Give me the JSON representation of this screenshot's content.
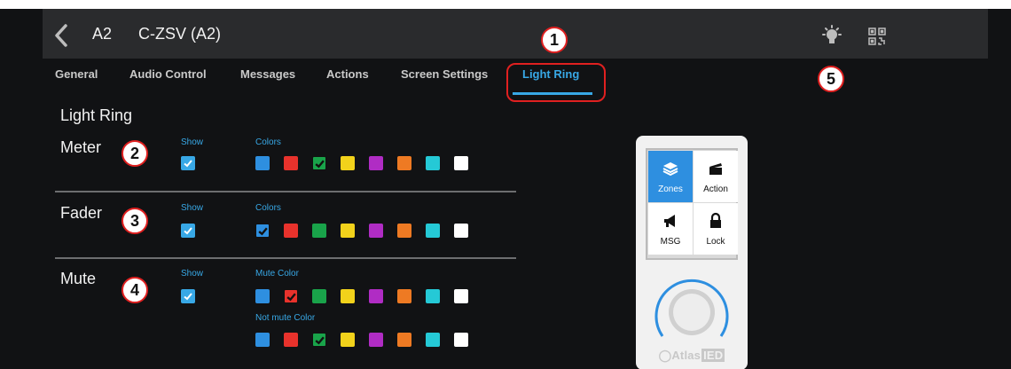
{
  "header": {
    "back_icon": "chevron-left-icon",
    "device_id": "A2",
    "device_title": "C-ZSV (A2)",
    "icons": [
      "light-bulb-icon",
      "qr-code-icon"
    ]
  },
  "tabs": [
    {
      "label": "General",
      "active": false
    },
    {
      "label": "Audio Control",
      "active": false
    },
    {
      "label": "Messages",
      "active": false
    },
    {
      "label": "Actions",
      "active": false
    },
    {
      "label": "Screen Settings",
      "active": false
    },
    {
      "label": "Light Ring",
      "active": true
    }
  ],
  "section_title": "Light Ring",
  "callouts": [
    "1",
    "2",
    "3",
    "4",
    "5"
  ],
  "accent_color": "#38a8e6",
  "palette": [
    "#2e8fe0",
    "#e8322c",
    "#19a34a",
    "#f2d21b",
    "#b02cc4",
    "#ee7a23",
    "#25c9d6",
    "#ffffff"
  ],
  "rows": {
    "meter": {
      "label": "Meter",
      "show_label": "Show",
      "show": true,
      "colors_label": "Colors",
      "selected_index": 2
    },
    "fader": {
      "label": "Fader",
      "show_label": "Show",
      "show": true,
      "colors_label": "Colors",
      "selected_index": 0
    },
    "mute": {
      "label": "Mute",
      "show_label": "Show",
      "show": true,
      "mute_color_label": "Mute Color",
      "mute_selected_index": 1,
      "not_mute_color_label": "Not mute Color",
      "not_mute_selected_index": 2
    }
  },
  "device_preview": {
    "cells": [
      {
        "label": "Zones",
        "icon": "layers-icon",
        "selected": true
      },
      {
        "label": "Action",
        "icon": "clapperboard-icon",
        "selected": false
      },
      {
        "label": "MSG",
        "icon": "megaphone-icon",
        "selected": false
      },
      {
        "label": "Lock",
        "icon": "lock-icon",
        "selected": false
      }
    ],
    "logo_text": "Atlas",
    "logo_suffix": "IED"
  }
}
